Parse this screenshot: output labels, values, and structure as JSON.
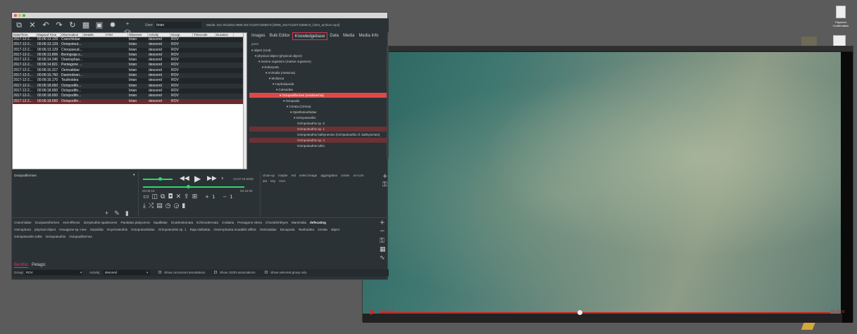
{
  "desktop": {
    "icon_label_1": "Payment",
    "icon_label_2": "Confirmation"
  },
  "toolbar": {
    "user_label": "User:",
    "user_value": "brian",
    "media_label": "Media: Doc Ricketts 0999 20171220T105957Z [0999_20171220T105957Z_h264_archive.mp4]"
  },
  "table": {
    "columns": [
      "Date/Time",
      "Elapsed Time",
      "Observation",
      "Details",
      "FOV",
      "Observer",
      "Activity",
      "Group",
      "Timecode",
      "Duration"
    ],
    "rows": [
      [
        "2017-12-2...",
        "00:06:13.129",
        "Cranchiidae",
        "",
        "",
        "brian",
        "descend",
        "ROV"
      ],
      [
        "2017-12-2...",
        "00:06:13.129",
        "Octopoteut...",
        "",
        "",
        "brian",
        "descend",
        "ROV"
      ],
      [
        "2017-12-2...",
        "00:06:13.129",
        "Crinopseud...",
        "",
        "",
        "brian",
        "descend",
        "ROV"
      ],
      [
        "2017-12-2...",
        "00:06:13.806",
        "Beringraja s...",
        "",
        "",
        "brian",
        "descend",
        "ROV"
      ],
      [
        "2017-12-2...",
        "00:06:14.245",
        "Oneirophan...",
        "",
        "",
        "brian",
        "descend",
        "ROV"
      ],
      [
        "2017-12-2...",
        "00:06:14.821",
        "Pentagone ...",
        "",
        "",
        "brian",
        "descend",
        "ROV"
      ],
      [
        "2017-12-2...",
        "00:06:15.317",
        "Oeirnatidae",
        "",
        "",
        "brian",
        "descend",
        "ROV"
      ],
      [
        "2017-12-2...",
        "00:06:15.760",
        "Dasmobran...",
        "",
        "",
        "brian",
        "descend",
        "ROV"
      ],
      [
        "2017-12-2...",
        "00:06:16.170",
        "Teuthoidea",
        "",
        "",
        "brian",
        "descend",
        "ROV"
      ],
      [
        "2017-12-2...",
        "00:06:18.650",
        "Octopodifo...",
        "",
        "",
        "brian",
        "descend",
        "ROV"
      ],
      [
        "2017-12-2...",
        "00:06:18.650",
        "Octopodifo...",
        "",
        "",
        "brian",
        "descend",
        "ROV"
      ],
      [
        "2017-12-2...",
        "00:06:18.650",
        "Octopodifo...",
        "",
        "",
        "brian",
        "descend",
        "ROV"
      ],
      [
        "2017-12-2...",
        "00:06:18.650",
        "Octopodifo...",
        "",
        "",
        "brian",
        "descend",
        "ROV"
      ]
    ]
  },
  "tabs": [
    "Images",
    "Bulk Editor",
    "Knowledgebase",
    "Data",
    "Media",
    "Media Info"
  ],
  "kb_sub_label": "parts",
  "tree": [
    "▾ object (root)",
    "▾ physical object (physical object)",
    "▾ marine organism (marine organism)",
    "▾ Eukaryota",
    "▾ Animalia (metazoa)",
    "▾ Mollusca",
    "▾ Cephalopoda",
    "▾ Coleoidea",
    "▾ Octopodiformes (octobrachia)",
    "▾ Octopoda",
    "▾ Cirrata (Cirrina)",
    "▾ Opisthoteuthidae",
    "▾ Grimpoteuthis",
    "Grimpoteuthis sp. 6",
    "Grimpoteuthis sp. 1",
    "Grimpoteuthis bathynectes (Grimpoteuthis cf. bathynectes)",
    "Grimpoteuthis sp. 4",
    "Grimpoteuthis tuftsi"
  ],
  "concept": {
    "name": "Octopodiformes"
  },
  "video_controls": {
    "timestamp_top": "12:57:19.693Z",
    "elapsed": "00:06:18",
    "duration": "00:15:06",
    "plus_one": "+1",
    "minus_one": "−1"
  },
  "associations": {
    "row1": [
      "close-up",
      "maybe",
      "red",
      "select image",
      "aggregation",
      "center",
      "on-com"
    ],
    "row2": [
      "dot",
      "tiny",
      "OVA"
    ]
  },
  "quick_buttons": {
    "row1": [
      "Cranchiidae",
      "Scorpaeniformes",
      "end-effector",
      "Doryteuthis opalescens",
      "Pandalus platyceros",
      "Squillidae",
      "Gnathostomata",
      "Echinodermata",
      "Cnidaria",
      "Pentagone vitrea",
      "Chondrichthyes",
      "Mammalia",
      "defecating"
    ],
    "row1_bold_index": 12,
    "row2": [
      "Ctenophora",
      "physical object",
      "Hexagone-sp.-new",
      "Sepiolida",
      "Onychoteuthis",
      "Octopoteuthidae",
      "Grimpoteuthis sp. 1",
      "Raja stellulata",
      "Oneirophanta mutabilis affinis",
      "Oeirnatidae",
      "Decapoda",
      "Teuthoidea",
      "Cirrata",
      "object"
    ],
    "row3": [
      "Grimpoteuthis tuftsi",
      "Grimpoteuthis",
      "Octopodiformes"
    ]
  },
  "bottom_tabs": [
    "Benthic",
    "Pelagic"
  ],
  "footer": {
    "group_label": "Group:",
    "group_value": "ROV",
    "activity_label": "Activity:",
    "activity_value": "descend",
    "chk1": "Show concurrent annotations",
    "chk2": "Show JSON associations",
    "chk3": "Show selected group only"
  },
  "video_player": {
    "time_left": "00:06:18",
    "time_right": "00:15:06"
  },
  "colors": {
    "accent": "#e04848",
    "selection": "#6c2a2c",
    "slider": "#2fd66a"
  }
}
